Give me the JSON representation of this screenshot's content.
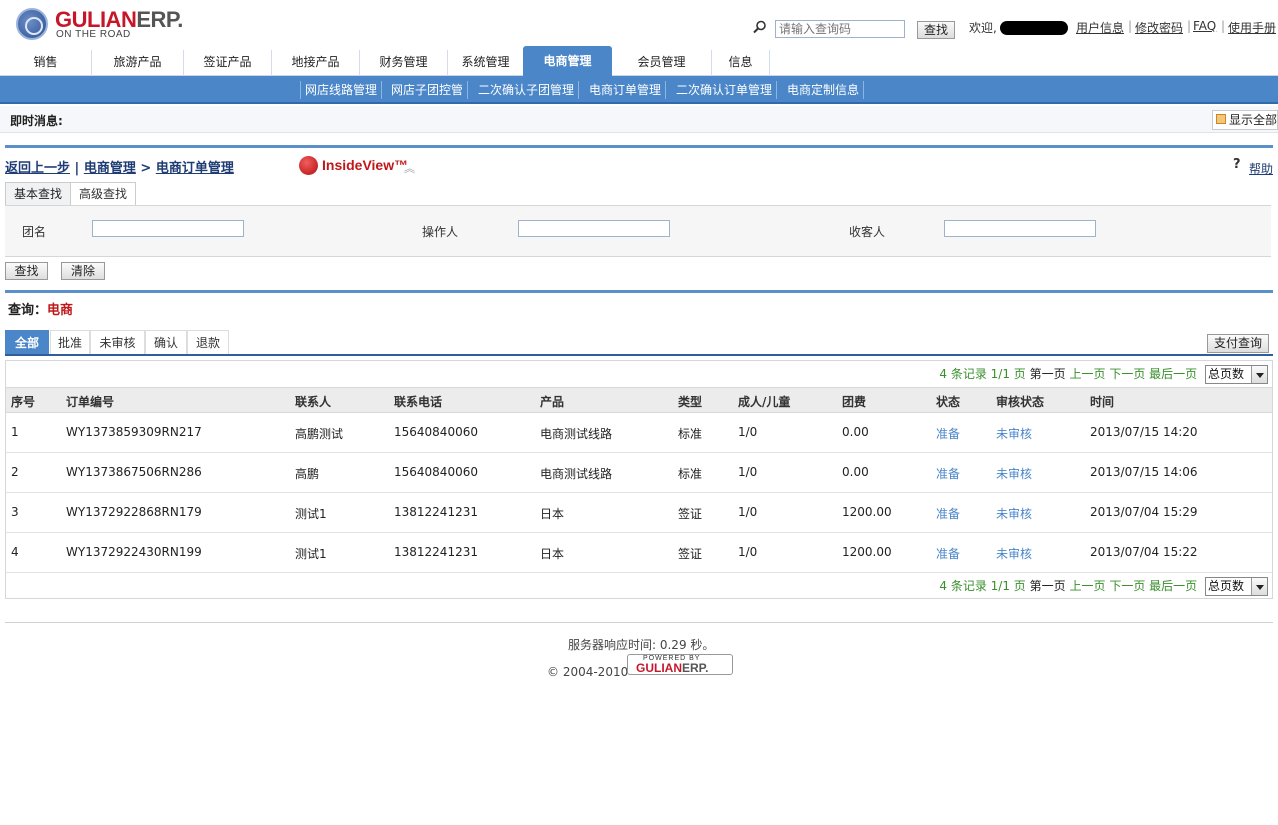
{
  "header": {
    "brand_main": "GULIAN",
    "brand_suffix": "ERP.",
    "tagline": "ON THE ROAD",
    "search_placeholder": "请输入查询码",
    "search_button": "查找",
    "welcome": "欢迎,",
    "links": [
      "用户信息",
      "修改密码",
      "FAQ",
      "使用手册"
    ]
  },
  "main_tabs": [
    "销售",
    "旅游产品",
    "签证产品",
    "地接产品",
    "财务管理",
    "系统管理",
    "电商管理",
    "会员管理",
    "信息"
  ],
  "main_tabs_active": "电商管理",
  "sub_nav": [
    "网店线路管理",
    "网店子团控管",
    "二次确认子团管理",
    "电商订单管理",
    "二次确认订单管理",
    "电商定制信息"
  ],
  "message_bar": {
    "label": "即时消息:",
    "show_all": "显示全部"
  },
  "breadcrumb": {
    "back": "返回上一步",
    "sep1": "|",
    "section": "电商管理",
    "sep2": ">",
    "page": "电商订单管理",
    "insideview": "InsideView™",
    "help": "帮助"
  },
  "search": {
    "tabs": [
      "基本查找",
      "高级查找"
    ],
    "fields": [
      {
        "label": "团名",
        "value": ""
      },
      {
        "label": "操作人",
        "value": ""
      },
      {
        "label": "收客人",
        "value": ""
      }
    ],
    "find_button": "查找",
    "clear_button": "清除"
  },
  "query": {
    "label": "查询：",
    "value": "电商"
  },
  "status_tabs": [
    "全部",
    "批准",
    "未审核",
    "确认",
    "退款"
  ],
  "status_tabs_active": "全部",
  "pay_query_button": "支付查询",
  "pager": {
    "records": "4 条记录",
    "pages": "1/1 页",
    "first": "第一页",
    "prev": "上一页",
    "next": "下一页",
    "last": "最后一页",
    "select": "总页数"
  },
  "table": {
    "columns": [
      "序号",
      "订单编号",
      "联系人",
      "联系电话",
      "产品",
      "类型",
      "成人/儿童",
      "团费",
      "状态",
      "审核状态",
      "时间"
    ],
    "rows": [
      [
        "1",
        "WY1373859309RN217",
        "高鹏测试",
        "15640840060",
        "电商测试线路",
        "标准",
        "1/0",
        "0.00",
        "准备",
        "未审核",
        "2013/07/15 14:20"
      ],
      [
        "2",
        "WY1373867506RN286",
        "高鹏",
        "15640840060",
        "电商测试线路",
        "标准",
        "1/0",
        "0.00",
        "准备",
        "未审核",
        "2013/07/15 14:06"
      ],
      [
        "3",
        "WY1372922868RN179",
        "测试1",
        "13812241231",
        "日本",
        "签证",
        "1/0",
        "1200.00",
        "准备",
        "未审核",
        "2013/07/04 15:29"
      ],
      [
        "4",
        "WY1372922430RN199",
        "测试1",
        "13812241231",
        "日本",
        "签证",
        "1/0",
        "1200.00",
        "准备",
        "未审核",
        "2013/07/04 15:22"
      ]
    ]
  },
  "footer": {
    "response_time": "服务器响应时间: 0.29 秒。",
    "copyright": "© 2004-2010",
    "powered_by": "POWERED BY",
    "powered_brand_main": "GULIAN",
    "powered_brand_suffix": "ERP."
  },
  "colors": {
    "accent_blue": "#4a86c8",
    "brand_red": "#c6172a",
    "pager_green": "#3a8f2c"
  },
  "icons": [
    "logo-emblem",
    "search-icon",
    "show-all-icon",
    "insideview-icon",
    "collapse-up-icon",
    "help-icon",
    "dropdown-arrow-icon"
  ]
}
